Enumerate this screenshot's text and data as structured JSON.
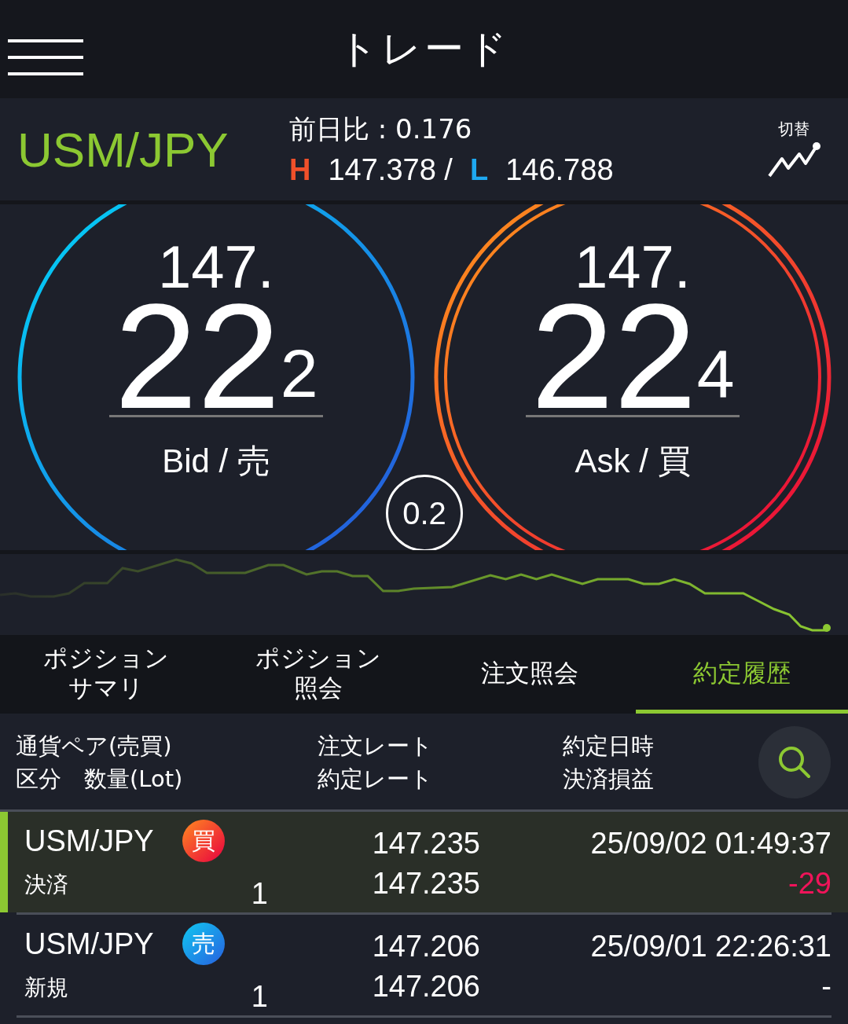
{
  "header": {
    "title": "トレード"
  },
  "pair": {
    "name": "USM/JPY",
    "change_label": "前日比 : 0.176",
    "high_mark": "H",
    "high": "147.378 /",
    "low_mark": "L",
    "low": "146.788",
    "switch_label": "切替"
  },
  "quotes": [
    {
      "kind": "bid",
      "head": "147.",
      "big": "22",
      "tail": "2",
      "label": "Bid / 売"
    },
    {
      "kind": "ask",
      "head": "147.",
      "big": "22",
      "tail": "4",
      "label": "Ask / 買"
    }
  ],
  "spread": "0.2",
  "tabs": [
    {
      "lines": [
        "ポジション",
        "サマリ"
      ],
      "selected": false
    },
    {
      "lines": [
        "ポジション",
        "照会"
      ],
      "selected": false
    },
    {
      "lines": [
        "注文照会"
      ],
      "selected": false
    },
    {
      "lines": [
        "約定履歴"
      ],
      "selected": true
    }
  ],
  "columns": [
    {
      "line_1": "通貨ペア(売買)",
      "line_2": "区分　数量(Lot)"
    },
    {
      "line_1": "注文レート",
      "line_2": "約定レート"
    },
    {
      "line_1": "約定日時",
      "line_2": "決済損益"
    }
  ],
  "rows": [
    {
      "selected": true,
      "pair": "USM/JPY",
      "badge": {
        "kind": "buy",
        "label": "買"
      },
      "category": "決済",
      "lots": "1",
      "order_rate": "147.235",
      "fill_rate": "147.235",
      "time": "25/09/02 01:49:37",
      "pl": {
        "kind": "loss",
        "text": "-29"
      }
    },
    {
      "selected": false,
      "pair": "USM/JPY",
      "badge": {
        "kind": "sell",
        "label": "売"
      },
      "category": "新規",
      "lots": "1",
      "order_rate": "147.206",
      "fill_rate": "147.206",
      "time": "25/09/01 22:26:31",
      "pl": {
        "kind": "neutral",
        "text": "-"
      }
    }
  ]
}
